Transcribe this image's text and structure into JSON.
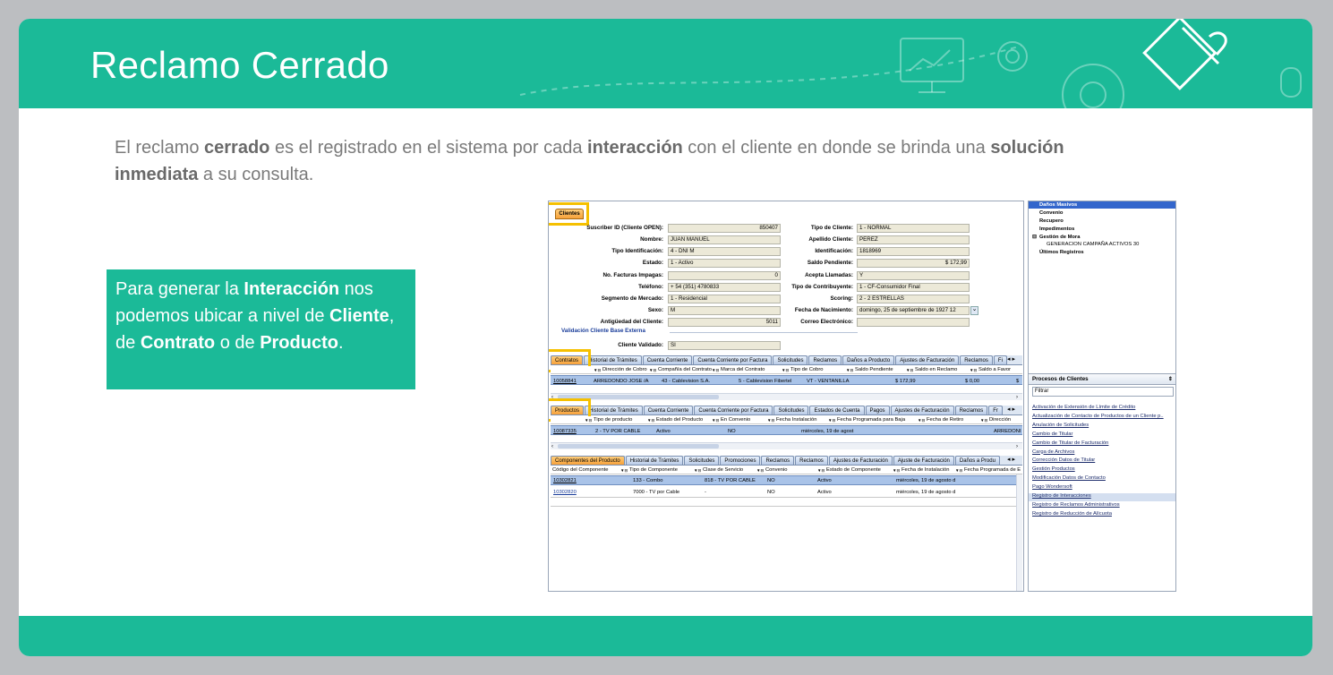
{
  "slide": {
    "title": "Reclamo Cerrado",
    "intro": [
      {
        "t": "El reclamo ",
        "b": false
      },
      {
        "t": "cerrado",
        "b": true
      },
      {
        "t": " es el registrado en el sistema por cada ",
        "b": false
      },
      {
        "t": "interacción",
        "b": true
      },
      {
        "t": "  con el cliente  en donde se brinda una ",
        "b": false
      },
      {
        "t": "solución  inmediata",
        "b": true
      },
      {
        "t": "  a su consulta.",
        "b": false
      }
    ],
    "callout": [
      {
        "t": "Para generar la ",
        "b": false
      },
      {
        "t": "Interacción",
        "b": true
      },
      {
        "t": " nos podemos ubicar a nivel de ",
        "b": false
      },
      {
        "t": "Cliente",
        "b": true
      },
      {
        "t": ", de ",
        "b": false
      },
      {
        "t": "Contrato",
        "b": true
      },
      {
        "t": " o de ",
        "b": false
      },
      {
        "t": "Producto",
        "b": true
      },
      {
        "t": ".",
        "b": false
      }
    ],
    "colors": {
      "teal": "#1bba98",
      "highlight": "#f5c000",
      "frame": "#bcbec1"
    }
  },
  "app": {
    "client_tab": "Clientes",
    "client_fields_left": [
      {
        "label": "Suscriber ID (Cliente OPEN):",
        "value": "850407",
        "align": "right"
      },
      {
        "label": "Nombre:",
        "value": "JUAN MANUEL",
        "align": "left"
      },
      {
        "label": "Tipo Identificación:",
        "value": "4 - DNI M",
        "align": "left"
      },
      {
        "label": "Estado:",
        "value": "1 - Activo",
        "align": "left"
      },
      {
        "label": "No. Facturas Impagas:",
        "value": "0",
        "align": "right"
      },
      {
        "label": "Teléfono:",
        "value": "+ 54 (351) 4780833",
        "align": "left"
      },
      {
        "label": "Segmento de Mercado:",
        "value": "1 - Residencial",
        "align": "left"
      },
      {
        "label": "Sexo:",
        "value": "M",
        "align": "left"
      },
      {
        "label": "Antigüedad del Cliente:",
        "value": "5011",
        "align": "right"
      }
    ],
    "client_fields_right": [
      {
        "label": "Tipo de Cliente:",
        "value": "1 - NORMAL",
        "align": "left"
      },
      {
        "label": "Apellido Cliente:",
        "value": "PEREZ",
        "align": "left"
      },
      {
        "label": "Identificación:",
        "value": "1818969",
        "align": "left"
      },
      {
        "label": "Saldo Pendiente:",
        "value": "$ 172,99",
        "align": "right"
      },
      {
        "label": "Acepta Llamadas:",
        "value": "Y",
        "align": "left"
      },
      {
        "label": "Tipo de Contribuyente:",
        "value": "1 - CF-Consumidor Final",
        "align": "left"
      },
      {
        "label": "Scoring:",
        "value": "2 - 2 ESTRELLAS",
        "align": "left"
      },
      {
        "label": "Fecha de Nacimiento:",
        "value": "domingo, 25 de septiembre de 1927 12",
        "align": "left"
      },
      {
        "label": "Correo Electrónico:",
        "value": "",
        "align": "left"
      }
    ],
    "validation_section": "Validación Cliente Base Externa",
    "validated_label": "Cliente Validado:",
    "validated_value": "SI",
    "contract_tabs": [
      "Contratos",
      "Historial de Trámites",
      "Cuenta Corriente",
      "Cuenta Corriente por Factura",
      "Solicitudes",
      "Reclamos",
      "Daños a Producto",
      "Ajustes de Facturación",
      "Reclamos",
      "Fi"
    ],
    "contract_cols": [
      "Dirección de Cobro",
      "Compañía del Contrato",
      "Marca del Contrato",
      "Tipo de Cobro",
      "Saldo Pendiente",
      "Saldo en Reclamo",
      "Saldo a Favor"
    ],
    "contract_row": [
      "10058841",
      "ARREDONDO JOSE /A",
      "43 - Cablevision S.A.",
      "5 - Cablevision Fibertel",
      "VT - VENTANILLA",
      "$ 172,99",
      "$ 0,00",
      "$"
    ],
    "product_tabs": [
      "Productos",
      "Historial de Trámites",
      "Cuenta Corriente",
      "Cuenta Corriente por Factura",
      "Solicitudes",
      "Estados de Cuenta",
      "Pagos",
      "Ajustes de Facturación",
      "Reclamos",
      "Fr"
    ],
    "product_cols": [
      "Tipo de producto",
      "Estado del Producto",
      "En Convenio",
      "Fecha Instalación",
      "Fecha Programada para Baja",
      "Fecha de Retiro",
      "Dirección"
    ],
    "product_row": [
      "10087335",
      "2 - TV POR CABLE",
      "Activo",
      "NO",
      "miércoles, 19 de agost",
      "ARREDONI"
    ],
    "component_tabs": [
      "Componentes del Producto",
      "Historial de Trámites",
      "Solicitudes",
      "Promociones",
      "Reclamos",
      "Reclamos",
      "Ajustes de Facturación",
      "Ajuste de Facturación",
      "Daños a Produ"
    ],
    "component_cols": [
      "Código del Componente",
      "Tipo de Componente",
      "Clase de Servicio",
      "Convenio",
      "Estado de Componente",
      "Fecha de Instalación",
      "Fecha Programada de E"
    ],
    "component_rows": [
      [
        "10302821",
        "133 - Combo",
        "818 - TV POR CABLE",
        "NO",
        "Activo",
        "miércoles, 19 de agosto d"
      ],
      [
        "10302820",
        "7000 - TV por Cable",
        "-",
        "NO",
        "Activo",
        "miércoles, 19 de agosto d"
      ]
    ],
    "tree_items": [
      "Daños Masivos",
      "Convenio",
      "Recupero",
      "Impedimentos",
      "Gestión de Mora",
      "GENERACION  CAMPAÑA  ACTIVOS  30",
      "Últimos Registros"
    ],
    "tree_expander": "⊟",
    "processes_title": "Procesos de Clientes",
    "filter_placeholder": "Filtrar",
    "process_items": [
      "Activación de Extensión de Límite de Crédito",
      "Actualización de Contacto de Productos de un Cliente p..",
      "Anulación de Solicitudes",
      "Cambio de Titular",
      "Cambio de Titular de Facturación",
      "Carga de Archivos",
      "Corrección Datos de Titular",
      "Gestión Productos",
      "Modificación Datos de Contacto",
      "Pago Wondersoft",
      "Registro de Interacciones",
      "Registro de Reclamos Administrativos",
      "Registro de Reducción de Alícuota"
    ]
  }
}
